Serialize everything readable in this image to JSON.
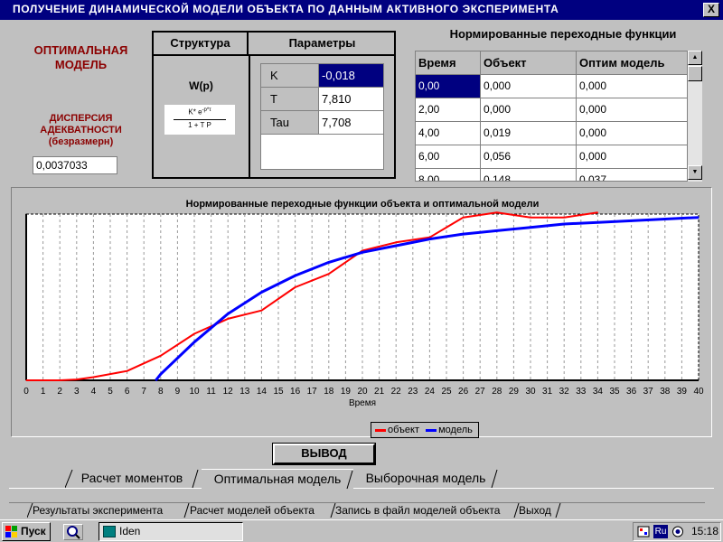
{
  "window": {
    "title": "ПОЛУЧЕНИЕ  ДИНАМИЧЕСКОЙ  МОДЕЛИ  ОБЪЕКТА  ПО  ДАННЫМ  АКТИВНОГО  ЭКСПЕРИМЕНТА",
    "close_label": "X"
  },
  "left": {
    "optimal_line1": "ОПТИМАЛЬНАЯ",
    "optimal_line2": "МОДЕЛЬ",
    "dispersion_line1": "ДИСПЕРСИЯ",
    "dispersion_line2": "АДЕКВАТНОСТИ",
    "dispersion_line3": "(безразмерн)",
    "dispersion_value": "0,0037033"
  },
  "structure": {
    "struct_header": "Структура",
    "params_header": "Параметры",
    "wp_label": "W(p)",
    "formula_numerator": "K* e",
    "formula_exponent": "-p*τ",
    "formula_denominator": "1 + T P",
    "params": [
      {
        "name": "K",
        "value": "-0,018"
      },
      {
        "name": "T",
        "value": "7,810"
      },
      {
        "name": "Tau",
        "value": "7,708"
      }
    ]
  },
  "grid": {
    "title": "Нормированные переходные функции",
    "headers": [
      "Время",
      "Объект",
      "Оптим модель"
    ],
    "rows": [
      [
        "0,00",
        "0,000",
        "0,000"
      ],
      [
        "2,00",
        "0,000",
        "0,000"
      ],
      [
        "4,00",
        "0,019",
        "0,000"
      ],
      [
        "6,00",
        "0,056",
        "0,000"
      ],
      [
        "8,00",
        "0,148",
        "0,037"
      ]
    ]
  },
  "chart_data": {
    "type": "line",
    "title": "Нормированные переходные функции объекта и оптимальной модели",
    "xlabel": "Время",
    "ylabel": "",
    "xlim": [
      0,
      40
    ],
    "ylim": [
      0,
      1
    ],
    "grid": true,
    "legend": "bottom",
    "series": [
      {
        "name": "объект",
        "color": "#ff0000",
        "points": [
          [
            0,
            0
          ],
          [
            2,
            0
          ],
          [
            3,
            0.005
          ],
          [
            4,
            0.019
          ],
          [
            6,
            0.056
          ],
          [
            8,
            0.148
          ],
          [
            10,
            0.28
          ],
          [
            12,
            0.37
          ],
          [
            14,
            0.42
          ],
          [
            16,
            0.56
          ],
          [
            18,
            0.64
          ],
          [
            20,
            0.78
          ],
          [
            22,
            0.83
          ],
          [
            24,
            0.86
          ],
          [
            26,
            0.98
          ],
          [
            28,
            1.01
          ],
          [
            30,
            0.98
          ],
          [
            32,
            0.98
          ],
          [
            34,
            1.01
          ]
        ]
      },
      {
        "name": "модель",
        "color": "#0000ff",
        "points": [
          [
            7.708,
            0
          ],
          [
            8,
            0.037
          ],
          [
            10,
            0.23
          ],
          [
            12,
            0.4
          ],
          [
            14,
            0.53
          ],
          [
            16,
            0.63
          ],
          [
            18,
            0.71
          ],
          [
            20,
            0.77
          ],
          [
            22,
            0.81
          ],
          [
            24,
            0.85
          ],
          [
            26,
            0.88
          ],
          [
            28,
            0.9
          ],
          [
            30,
            0.92
          ],
          [
            32,
            0.94
          ],
          [
            34,
            0.95
          ],
          [
            36,
            0.96
          ],
          [
            38,
            0.97
          ],
          [
            40,
            0.98
          ]
        ]
      }
    ],
    "tick_labels": [
      "0",
      "1",
      "2",
      "3",
      "4",
      "5",
      "6",
      "7",
      "8",
      "9",
      "10",
      "11",
      "12",
      "13",
      "14",
      "15",
      "16",
      "17",
      "18",
      "19",
      "20",
      "21",
      "22",
      "23",
      "24",
      "25",
      "26",
      "27",
      "28",
      "29",
      "30",
      "31",
      "32",
      "33",
      "34",
      "35",
      "36",
      "37",
      "38",
      "39",
      "40"
    ]
  },
  "buttons": {
    "output": "ВЫВОД"
  },
  "tabs_top": [
    {
      "label": "Расчет  моментов"
    },
    {
      "label": "Оптимальная модель"
    },
    {
      "label": "Выборочная модель"
    }
  ],
  "tabs_bottom": [
    {
      "label": "Результаты  эксперимента"
    },
    {
      "label": "Расчет моделей объекта"
    },
    {
      "label": "Запись в файл моделей объекта"
    },
    {
      "label": "Выход"
    }
  ],
  "taskbar": {
    "start_label": "Пуск",
    "task_label": "Iden",
    "lang": "Ru",
    "clock": "15:18"
  },
  "colors": {
    "titlebar": "#000080",
    "accent_red": "#8b0000",
    "object_series": "#ff0000",
    "model_series": "#0000ff"
  }
}
